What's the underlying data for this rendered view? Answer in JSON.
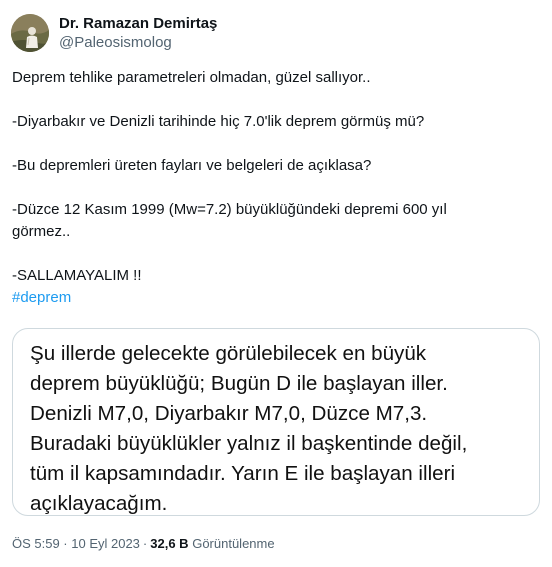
{
  "author": {
    "display_name": "Dr. Ramazan Demirtaş",
    "handle": "@Paleosismolog"
  },
  "tweet": {
    "lines": [
      "Deprem tehlike parametreleri olmadan, güzel sallıyor..",
      "",
      "-Diyarbakır ve Denizli tarihinde hiç 7.0'lik deprem görmüş mü?",
      "",
      "-Bu depremleri üreten fayları ve belgeleri de açıklasa?",
      "",
      "-Düzce 12 Kasım 1999 (Mw=7.2) büyüklüğündeki depremi 600 yıl",
      "görmez..",
      "",
      "-SALLAMAYALIM !!"
    ],
    "hashtag": "#deprem"
  },
  "media": {
    "lines": [
      "Şu illerde gelecekte görülebilecek en büyük",
      "deprem büyüklüğü; Bugün D ile başlayan iller.",
      "Denizli M7,0, Diyarbakır M7,0, Düzce M7,3.",
      "Buradaki büyüklükler yalnız il başkentinde değil,",
      "tüm il kapsamındadır. Yarın E ile başlayan illeri",
      "açıklayacağım."
    ]
  },
  "footer": {
    "timestamp": "ÖS 5:59 · 10 Eyl 2023",
    "separator": "·",
    "views_count": "32,6 B",
    "views_label": "Görüntülenme"
  },
  "colors": {
    "text": "#0f1419",
    "secondary": "#536471",
    "link": "#1d9bf0",
    "border": "#cfd9de"
  }
}
